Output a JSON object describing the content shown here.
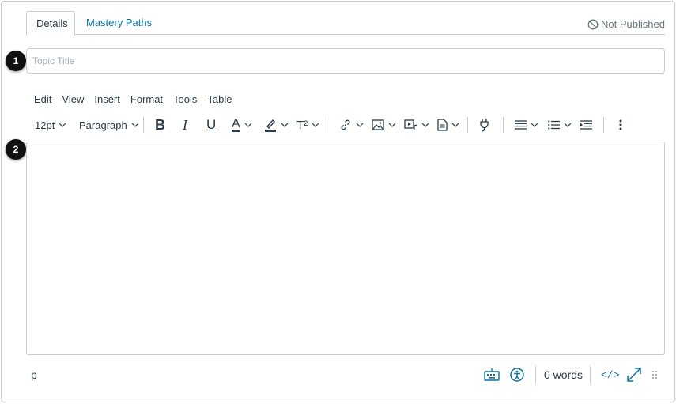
{
  "tabs": [
    {
      "label": "Details"
    },
    {
      "label": "Mastery Paths"
    }
  ],
  "publish_status": "Not Published",
  "title_field": {
    "placeholder": "Topic Title",
    "value": ""
  },
  "badges": [
    "1",
    "2"
  ],
  "menubar": [
    "Edit",
    "View",
    "Insert",
    "Format",
    "Tools",
    "Table"
  ],
  "toolbar": {
    "font_size": "12pt",
    "block_format": "Paragraph",
    "bold": "B",
    "italic": "I",
    "underline": "U",
    "text_color": "A",
    "superscript": "T²"
  },
  "statusbar": {
    "element_path": "p",
    "word_count": "0 words",
    "html_toggle": "</>"
  },
  "colors": {
    "accent": "#0770a3",
    "text": "#2d3b45",
    "border": "#c7cdd1"
  }
}
